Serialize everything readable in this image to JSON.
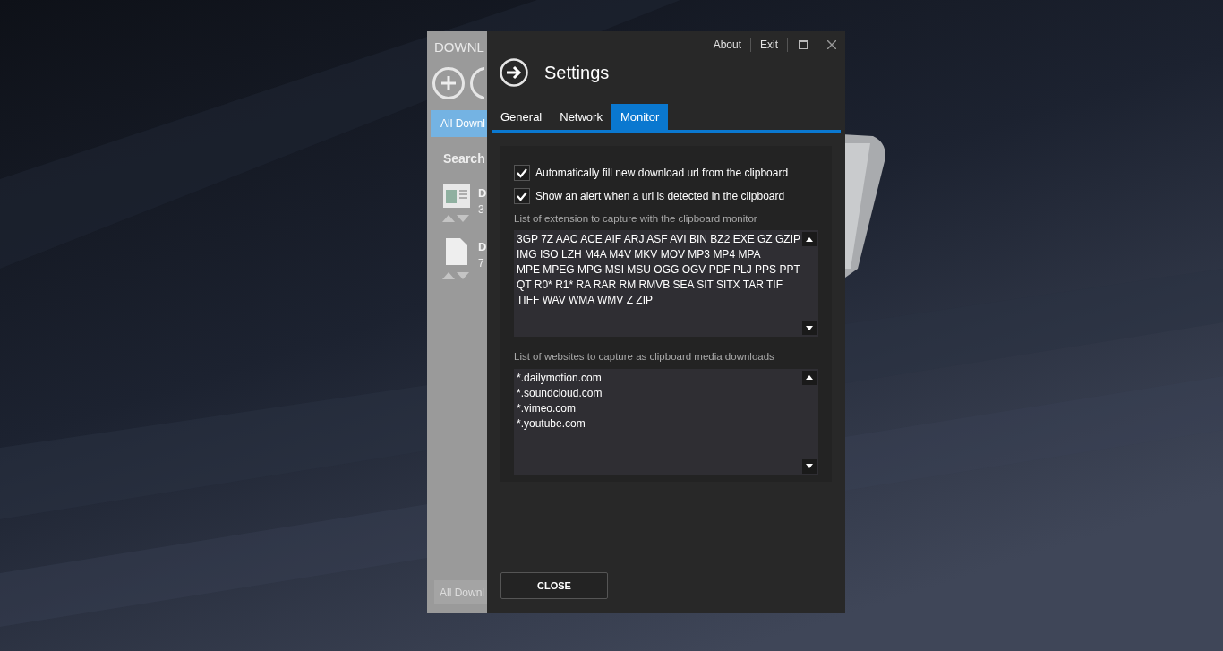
{
  "background_window": {
    "title": "DOWNL",
    "tab": "All Downl",
    "search_label": "Search",
    "items": [
      {
        "kind": "document",
        "title": "D",
        "subtitle": "3"
      },
      {
        "kind": "file",
        "title": "D",
        "subtitle": "7"
      }
    ],
    "footer_tab": "All Downl"
  },
  "dialog": {
    "links": [
      "About",
      "Exit"
    ],
    "title": "Settings",
    "tabs": [
      {
        "label": "General",
        "selected": false
      },
      {
        "label": "Network",
        "selected": false
      },
      {
        "label": "Monitor",
        "selected": true
      }
    ],
    "checkboxes": [
      {
        "label": "Automatically fill new download url from the clipboard",
        "checked": true
      },
      {
        "label": "Show an alert when a url is detected in the clipboard",
        "checked": true
      }
    ],
    "lists": [
      {
        "label": "List of extension to capture with the clipboard monitor",
        "lines": [
          "3GP 7Z AAC ACE AIF ARJ ASF AVI BIN BZ2 EXE GZ GZIP",
          "IMG ISO LZH M4A M4V MKV MOV MP3 MP4 MPA",
          "MPE MPEG MPG MSI MSU OGG OGV PDF PLJ PPS PPT",
          "QT R0* R1* RA RAR RM RMVB SEA SIT SITX TAR TIF",
          "TIFF WAV WMA WMV Z ZIP"
        ]
      },
      {
        "label": "List of websites to capture as clipboard media downloads",
        "lines": [
          "*.dailymotion.com",
          "*.soundcloud.com",
          "*.vimeo.com",
          "*.youtube.com"
        ]
      }
    ],
    "close_button": "CLOSE"
  }
}
